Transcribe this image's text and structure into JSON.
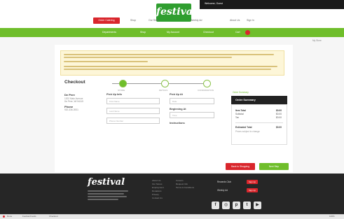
{
  "header": {
    "logo": "festival",
    "top_right_link": "Welcome, Guest"
  },
  "nav_primary": {
    "cta": "Order Catering",
    "links": [
      "Shop",
      "Our Store",
      "Weekly Ad",
      "About Us",
      "Sign In"
    ]
  },
  "nav_secondary": {
    "links": [
      "Departments",
      "Shop",
      "My Account",
      "Checkout",
      "Cart"
    ]
  },
  "account_link": "My Store",
  "checkout": {
    "title": "Checkout",
    "steps": [
      "STORE",
      "DETAILS",
      "CONFIRMATION"
    ],
    "store_heading": "De Pere",
    "store_address": [
      "1202 Main Avenue",
      "De Pere, WI 54115"
    ],
    "phone_heading": "Phone",
    "phone": "920-336-3931",
    "pickup_heading": "Pick Up Info",
    "pickup_fields": [
      "First Name",
      "Last Name",
      "Phone Number"
    ],
    "pickup_at_heading": "Pick Up At",
    "pickup_at_value": "Date",
    "beginning_heading": "Beginning At",
    "beginning_value": "Time",
    "instructions_heading": "Instructions"
  },
  "summary": {
    "tag": "Order Summary",
    "title": "Order Summary",
    "item_total_label": "Item Total",
    "item_total_value": "$0.00",
    "lines": [
      {
        "label": "Subtotal",
        "value": "$0.00"
      },
      {
        "label": "Tax",
        "value": "$0.00"
      }
    ],
    "estimated_label": "Estimated Total",
    "estimated_value": "$0.00",
    "note": "Prices subject to change"
  },
  "actions": {
    "back": "Back to Shopping",
    "next": "Next Step"
  },
  "footer": {
    "logo": "festival",
    "col1": [
      "About Us",
      "Our Stores",
      "Employment",
      "Donations",
      "Privacy",
      "Contact Us"
    ],
    "col2": [
      "Careers",
      "Request Info",
      "Terms & Conditions"
    ],
    "rewards_label": "Rewards Club",
    "rewards_button": "Sign Up",
    "newsletter_label": "Weekly Ad",
    "newsletter_button": "Sign Up",
    "social_icons": [
      "facebook",
      "instagram",
      "pinterest",
      "twitter",
      "youtube"
    ]
  },
  "status_bar": {
    "items": [
      "Done",
      "Festival Foods",
      "Checkout"
    ],
    "right": "100%"
  },
  "colors": {
    "brand_green": "#6fbe2b",
    "brand_red": "#d9262c",
    "dark": "#262626"
  }
}
